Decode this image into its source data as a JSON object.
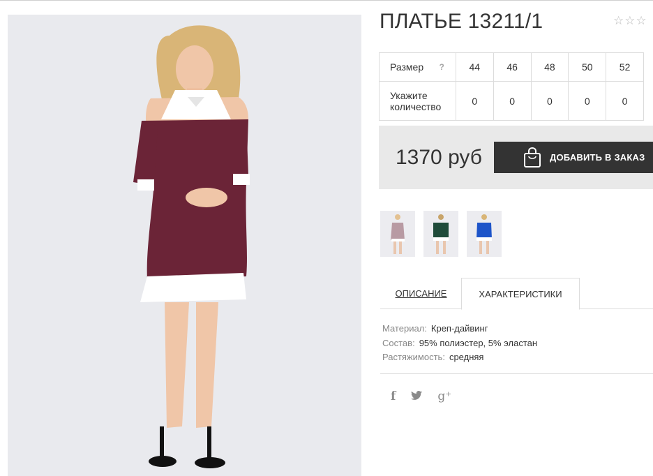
{
  "product": {
    "title": "ПЛАТЬЕ 13211/1",
    "rating_stars": [
      "☆",
      "☆",
      "☆"
    ],
    "price": "1370 руб",
    "add_to_order_label": "ДОБАВИТЬ В ЗАКАЗ"
  },
  "sizes": {
    "size_label": "Размер",
    "help_label": "?",
    "qty_label": "Укажите количество",
    "values": [
      "44",
      "46",
      "48",
      "50",
      "52"
    ],
    "quantities": [
      "0",
      "0",
      "0",
      "0",
      "0"
    ]
  },
  "thumbnails": [
    {
      "name": "thumb-burgundy",
      "color": "#6b2437"
    },
    {
      "name": "thumb-green",
      "color": "#1f4b3a"
    },
    {
      "name": "thumb-blue",
      "color": "#1d54c9"
    }
  ],
  "tabs": {
    "description": "ОПИСАНИЕ",
    "characteristics": "ХАРАКТЕРИСТИКИ"
  },
  "specs": [
    {
      "key": "Материал:",
      "value": "Креп-дайвинг"
    },
    {
      "key": "Состав:",
      "value": "95% полиэстер, 5% эластан"
    },
    {
      "key": "Растяжимость:",
      "value": "средняя"
    }
  ],
  "social": {
    "facebook": "f",
    "twitter": "🐦",
    "google": "g⁺"
  },
  "colors": {
    "button_bg": "#333333",
    "price_bg": "#e9e9e9",
    "dress": "#6b2437"
  }
}
